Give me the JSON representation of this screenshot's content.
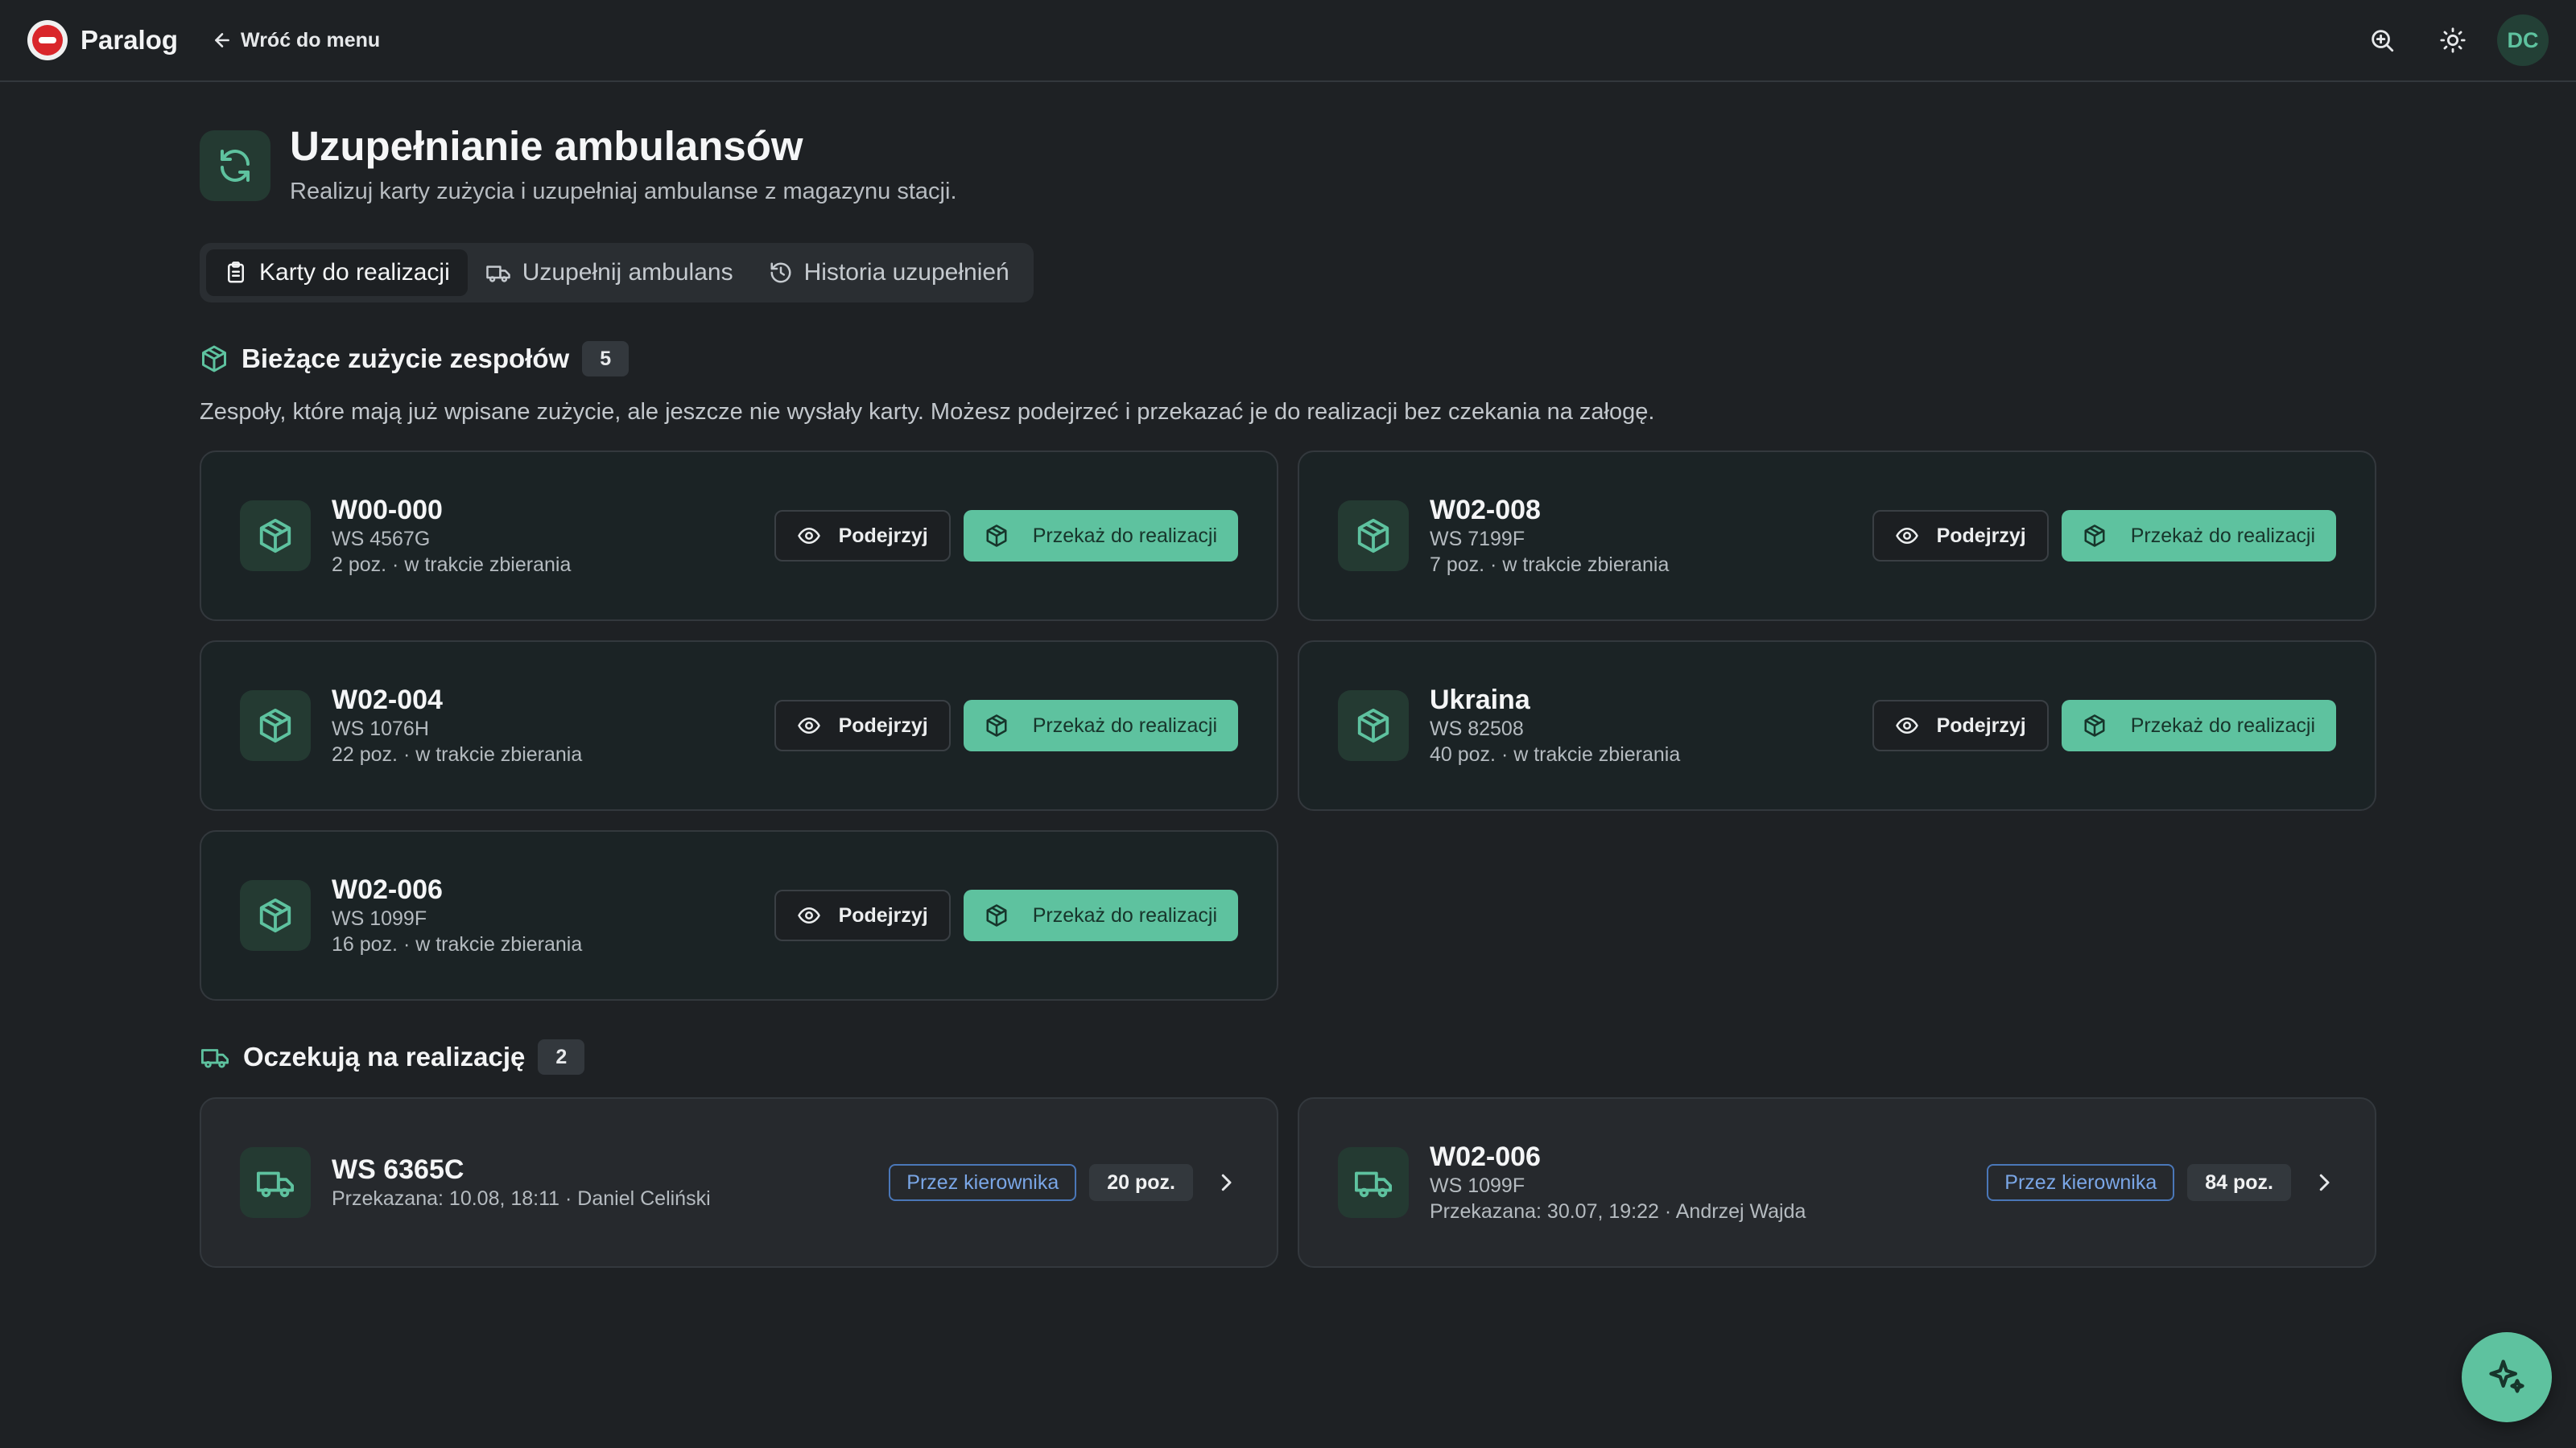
{
  "app": {
    "brand": "Paralog",
    "back_label": "Wróć do menu",
    "user_initials": "DC"
  },
  "header": {
    "title": "Uzupełnianie ambulansów",
    "subtitle": "Realizuj karty zużycia i uzupełniaj ambulanse z magazynu stacji."
  },
  "tabs": [
    {
      "label": "Karty do realizacji",
      "icon": "clipboard-icon",
      "active": true
    },
    {
      "label": "Uzupełnij ambulans",
      "icon": "truck-icon",
      "active": false
    },
    {
      "label": "Historia uzupełnień",
      "icon": "history-icon",
      "active": false
    }
  ],
  "current": {
    "title": "Bieżące zużycie zespołów",
    "count": "5",
    "description": "Zespoły, które mają już wpisane zużycie, ale jeszcze nie wysłały karty. Możesz podejrzeć i przekazać je do realizacji bez czekania na załogę.",
    "preview_label": "Podejrzyj",
    "forward_label": "Przekaż do realizacji",
    "cards": [
      {
        "team": "W00-000",
        "vehicle": "WS 4567G",
        "status": "2 poz. · w trakcie zbierania"
      },
      {
        "team": "W02-008",
        "vehicle": "WS 7199F",
        "status": "7 poz. · w trakcie zbierania"
      },
      {
        "team": "W02-004",
        "vehicle": "WS 1076H",
        "status": "22 poz. · w trakcie zbierania"
      },
      {
        "team": "Ukraina",
        "vehicle": "WS 82508",
        "status": "40 poz. · w trakcie zbierania"
      },
      {
        "team": "W02-006",
        "vehicle": "WS 1099F",
        "status": "16 poz. · w trakcie zbierania"
      }
    ]
  },
  "pending": {
    "title": "Oczekują na realizację",
    "count": "2",
    "cards": [
      {
        "title": "WS 6365C",
        "vehicle": "",
        "handed": "Przekazana: 10.08, 18:11 · Daniel Celiński",
        "tag": "Przez kierownika",
        "items": "20 poz."
      },
      {
        "title": "W02-006",
        "vehicle": "WS 1099F",
        "handed": "Przekazana: 30.07, 19:22 · Andrzej Wajda",
        "tag": "Przez kierownika",
        "items": "84 poz."
      }
    ]
  },
  "colors": {
    "accent": "#5ec29f",
    "background": "#1e2124",
    "tag_blue": "#7aa6e6"
  }
}
